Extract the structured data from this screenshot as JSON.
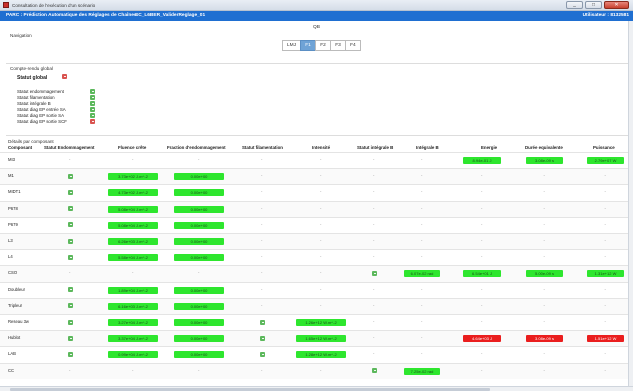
{
  "window": {
    "title": "Consultation de l'exécution d'un scénario",
    "controls": {
      "minimize": "_",
      "maximize": "□",
      "close": "✕"
    }
  },
  "app": {
    "title": "PARC : Prédiction Automatique des Réglages de Chaînes",
    "scenario": "SC_L6BER_ValiderReglage_01",
    "user": "Utilisateur : 8132581"
  },
  "qb": "QB",
  "navigation": {
    "title": "Navigation",
    "tabs": [
      "LMJ",
      "F1",
      "F2",
      "F3",
      "F4"
    ],
    "active": "F1"
  },
  "global_report": {
    "title": "Compte-rendu global",
    "status_global_label": "Statut global",
    "status_global": "ko",
    "items": [
      {
        "label": "Statut endommagement",
        "status": "ok"
      },
      {
        "label": "Statut filamentation",
        "status": "ok"
      },
      {
        "label": "Statut intégrale B",
        "status": "ok"
      },
      {
        "label": "Statut diag EP entrée SA",
        "status": "ok"
      },
      {
        "label": "Statut diag EP sortie SA",
        "status": "ok"
      },
      {
        "label": "Statut diag EP sortie SCF",
        "status": "ko"
      }
    ]
  },
  "details": {
    "title": "Détails par composant",
    "columns": [
      "Composant",
      "Statut Endommagement",
      "Fluence crête",
      "Fraction d'endommagement",
      "Statut filamentation",
      "Intensité",
      "Statut intégrale B",
      "Intégrale B",
      "Energie",
      "Durée equivalente",
      "Puissance"
    ],
    "rows": [
      {
        "name": "MI3",
        "endo": "-",
        "fluence": "-",
        "fraction": "-",
        "fil": "-",
        "intensite": "-",
        "intB_status": "-",
        "intB": "-",
        "energie": {
          "v": "8.94e-01 J",
          "c": "green"
        },
        "duree": {
          "v": "3.08e-09 s",
          "c": "green"
        },
        "puissance": {
          "v": "2.79e+07 W",
          "c": "green"
        }
      },
      {
        "name": "M1",
        "endo": "ok",
        "fluence": "3.73e+02 J.m^-2",
        "fraction": "0.00e+00",
        "fil": "-",
        "intensite": "-",
        "intB_status": "-",
        "intB": "-",
        "energie": "-",
        "duree": "-",
        "puissance": "-"
      },
      {
        "name": "MIDT1",
        "endo": "ok",
        "fluence": "4.73e+02 J.m^-2",
        "fraction": "0.00e+00",
        "fil": "-",
        "intensite": "-",
        "intB_status": "-",
        "intB": "-",
        "energie": "-",
        "duree": "-",
        "puissance": "-"
      },
      {
        "name": "P678",
        "endo": "ok",
        "fluence": "5.08e+04 J.m^-2",
        "fraction": "0.00e+00",
        "fil": "-",
        "intensite": "-",
        "intB_status": "-",
        "intB": "-",
        "energie": "-",
        "duree": "-",
        "puissance": "-"
      },
      {
        "name": "P679",
        "endo": "ok",
        "fluence": "5.08e+04 J.m^-2",
        "fraction": "0.00e+00",
        "fil": "-",
        "intensite": "-",
        "intB_status": "-",
        "intB": "-",
        "energie": "-",
        "duree": "-",
        "puissance": "-"
      },
      {
        "name": "L3",
        "endo": "ok",
        "fluence": "6.26e+03 J.m^-2",
        "fraction": "0.00e+00",
        "fil": "-",
        "intensite": "-",
        "intB_status": "-",
        "intB": "-",
        "energie": "-",
        "duree": "-",
        "puissance": "-"
      },
      {
        "name": "L4",
        "endo": "ok",
        "fluence": "5.58e+04 J.m^-2",
        "fraction": "0.00e+00",
        "fil": "-",
        "intensite": "-",
        "intB_status": "-",
        "intB": "-",
        "energie": "-",
        "duree": "-",
        "puissance": "-"
      },
      {
        "name": "CSO",
        "endo": "-",
        "fluence": "-",
        "fraction": "-",
        "fil": "-",
        "intensite": "-",
        "intB_status": "ok",
        "intB": {
          "v": "6.07e-02 rad",
          "c": "green"
        },
        "energie": {
          "v": "6.54e+01 J",
          "c": "green"
        },
        "duree": {
          "v": "5.00e-09 s",
          "c": "green"
        },
        "puissance": {
          "v": "1.31e+12 W",
          "c": "green"
        }
      },
      {
        "name": "Doubleur",
        "endo": "ok",
        "fluence": "1.89e+04 J.m^-2",
        "fraction": "0.00e+00",
        "fil": "-",
        "intensite": "-",
        "intB_status": "-",
        "intB": "-",
        "energie": "-",
        "duree": "-",
        "puissance": "-"
      },
      {
        "name": "Tripleur",
        "endo": "ok",
        "fluence": "6.16e+03 J.m^-2",
        "fraction": "0.00e+00",
        "fil": "-",
        "intensite": "-",
        "intB_status": "-",
        "intB": "-",
        "energie": "-",
        "duree": "-",
        "puissance": "-"
      },
      {
        "name": "Reseau 3w",
        "endo": "ok",
        "fluence": "3.27e+04 J.m^-2",
        "fraction": "0.00e+00",
        "fil": "ok",
        "intensite": {
          "v": "1.26e+12 W.m^-2",
          "c": "green"
        },
        "intB_status": "-",
        "intB": "-",
        "energie": "-",
        "duree": "-",
        "puissance": "-"
      },
      {
        "name": "Hublot",
        "endo": "ok",
        "fluence": "3.37e+04 J.m^-2",
        "fraction": "0.00e+00",
        "fil": "ok",
        "intensite": {
          "v": "1.65e+12 W.m^-2",
          "c": "green"
        },
        "intB_status": "-",
        "intB": "-",
        "energie": {
          "v": "4.64e+03 J",
          "c": "red"
        },
        "duree": {
          "v": "3.08e-09 s",
          "c": "red"
        },
        "puissance": {
          "v": "1.51e+12 W",
          "c": "red"
        }
      },
      {
        "name": "LAB",
        "endo": "ok",
        "fluence": "0.99e+04 J.m^-2",
        "fraction": "0.00e+00",
        "fil": "ok",
        "intensite": {
          "v": "1.28e+12 W.m^-2",
          "c": "green"
        },
        "intB_status": "-",
        "intB": "-",
        "energie": "-",
        "duree": "-",
        "puissance": "-"
      },
      {
        "name": "CC",
        "endo": "-",
        "fluence": "-",
        "fraction": "-",
        "fil": "-",
        "intensite": "-",
        "intB_status": "ok",
        "intB": {
          "v": "7.25e-02 rad",
          "c": "green"
        },
        "energie": "-",
        "duree": "-",
        "puissance": "-"
      }
    ]
  },
  "colors": {
    "appbar": "#1f6fd1",
    "ok": "#5cb85c",
    "ko": "#d9534f",
    "green_cell": "#2ee62e",
    "red_cell": "#ea1e1e",
    "tab_active": "#6fa3d6"
  }
}
